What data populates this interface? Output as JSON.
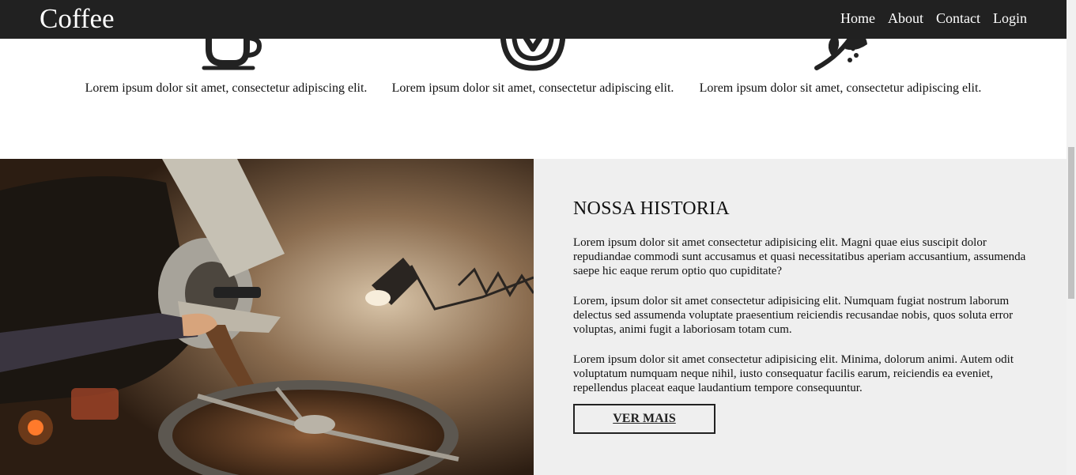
{
  "header": {
    "logo": "Coffee",
    "nav": [
      {
        "label": "Home"
      },
      {
        "label": "About"
      },
      {
        "label": "Contact"
      },
      {
        "label": "Login"
      }
    ]
  },
  "features": [
    {
      "icon": "coffee-cup-icon",
      "text": "Lorem ipsum dolor sit amet, consectetur adipiscing elit."
    },
    {
      "icon": "latte-art-icon",
      "text": "Lorem ipsum dolor sit amet, consectetur adipiscing elit."
    },
    {
      "icon": "coffee-branch-icon",
      "text": "Lorem ipsum dolor sit amet, consectetur adipiscing elit."
    }
  ],
  "story": {
    "title": "NOSSA HISTORIA",
    "paragraphs": [
      "Lorem ipsum dolor sit amet consectetur adipisicing elit. Magni quae eius suscipit dolor repudiandae commodi sunt accusamus et quasi necessitatibus aperiam accusantium, assumenda saepe hic eaque rerum optio quo cupiditate?",
      "Lorem, ipsum dolor sit amet consectetur adipisicing elit. Numquam fugiat nostrum laborum delectus sed assumenda voluptate praesentium reiciendis recusandae nobis, quos soluta error voluptas, animi fugit a laboriosam totam cum.",
      "Lorem ipsum dolor sit amet consectetur adipisicing elit. Minima, dolorum animi. Autem odit voluptatum numquam neque nihil, iusto consequatur facilis earum, reiciendis ea eveniet, repellendus placeat eaque laudantium tempore consequuntur."
    ],
    "button": "VER MAIS",
    "photo_icon": "coffee-roaster-photo"
  },
  "colors": {
    "header_bg": "#212121",
    "story_bg": "#efefef",
    "text": "#111111"
  }
}
